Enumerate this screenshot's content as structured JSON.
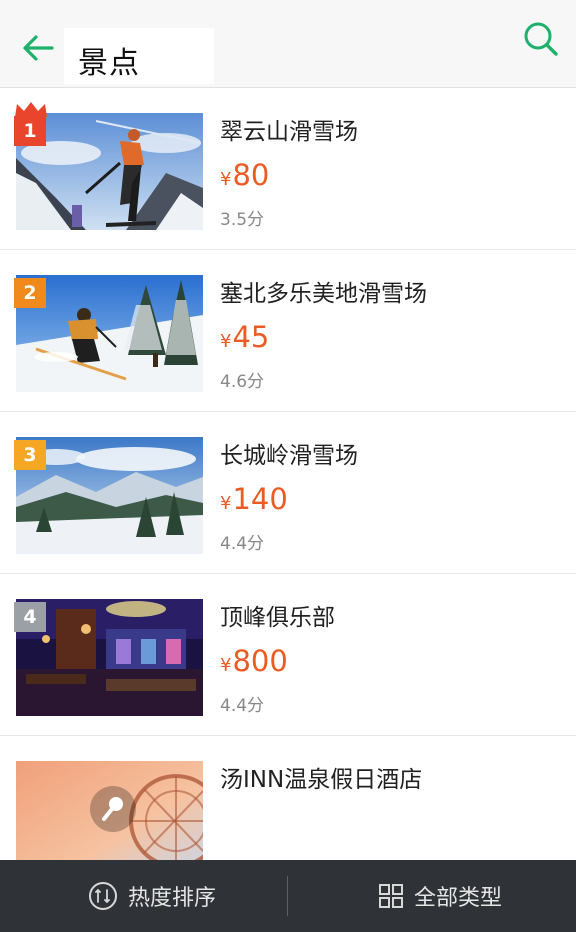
{
  "header": {
    "title": "景点",
    "back_icon": "arrow-left-icon",
    "search_icon": "search-icon",
    "accent_color": "#1fb06a"
  },
  "list": {
    "items": [
      {
        "rank": "1",
        "name": "翠云山滑雪场",
        "currency": "¥",
        "price": "80",
        "score": "3.5分",
        "thumb": "skier-downhill"
      },
      {
        "rank": "2",
        "name": "塞北多乐美地滑雪场",
        "currency": "¥",
        "price": "45",
        "score": "4.6分",
        "thumb": "skier-snowy-trees"
      },
      {
        "rank": "3",
        "name": "长城岭滑雪场",
        "currency": "¥",
        "price": "140",
        "score": "4.4分",
        "thumb": "snowy-valley"
      },
      {
        "rank": "4",
        "name": "顶峰俱乐部",
        "currency": "¥",
        "price": "800",
        "score": "4.4分",
        "thumb": "night-club"
      },
      {
        "rank": "",
        "name": "汤INN温泉假日酒店",
        "currency": "",
        "price": "",
        "score": "",
        "thumb": "ferris-wheel-sunset"
      }
    ],
    "price_color": "#ec5b24",
    "rank_colors": [
      "#e8452c",
      "#f08a1c",
      "#f5a623",
      "#9aa0a6"
    ]
  },
  "bottom_bar": {
    "sort_label": "热度排序",
    "sort_icon": "sort-hot-icon",
    "category_label": "全部类型",
    "category_icon": "grid-icon"
  }
}
